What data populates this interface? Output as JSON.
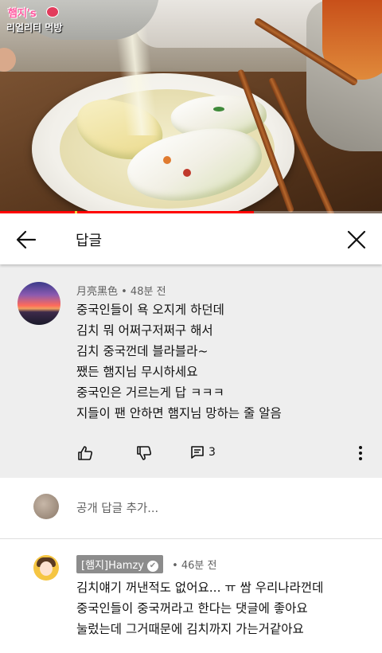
{
  "video": {
    "channel_logo_line1": "햄지's",
    "channel_logo_line2": "리얼리티 먹방",
    "progress": 0.665,
    "buffer_marker": 0.195
  },
  "header": {
    "back_icon": "arrow-left-icon",
    "title": "답글",
    "close_icon": "close-icon"
  },
  "comment": {
    "author": "月亮黑色",
    "time": "48분 전",
    "author_line": "月亮黑色 • 48분 전",
    "lines": [
      "중국인들이 욕 오지게 하던데",
      "김치 뭐 어쩌구저쩌구 해서",
      "김치 중국껀데 블라블라~",
      "쨌든 햄지님 무시하세요",
      "중국인은 거르는게 답 ㅋㅋㅋ",
      "지들이 팬 안하면 햄지님 망하는 줄 알음"
    ],
    "reply_count": "3",
    "like_icon": "thumbs-up-icon",
    "dislike_icon": "thumbs-down-icon",
    "reply_icon": "comment-icon",
    "more_icon": "more-vertical-icon"
  },
  "add_reply": {
    "placeholder": "공개 답글 추가..."
  },
  "reply": {
    "author": "[햄지]Hamzy",
    "time": "• 46분 전",
    "verified_icon": "verified-check-icon",
    "lines": [
      "김치얘기 꺼낸적도 없어요... ㅠ  쌈 우리나라껀데",
      "중국인들이 중국꺼라고 한다는 댓글에 좋아요",
      "눌렀는데 그거때문에 김치까지 가는거같아요"
    ]
  },
  "colors": {
    "progress": "#ff0000",
    "comment_bg": "#eeeeee",
    "badge_bg": "#8c8c8c"
  }
}
